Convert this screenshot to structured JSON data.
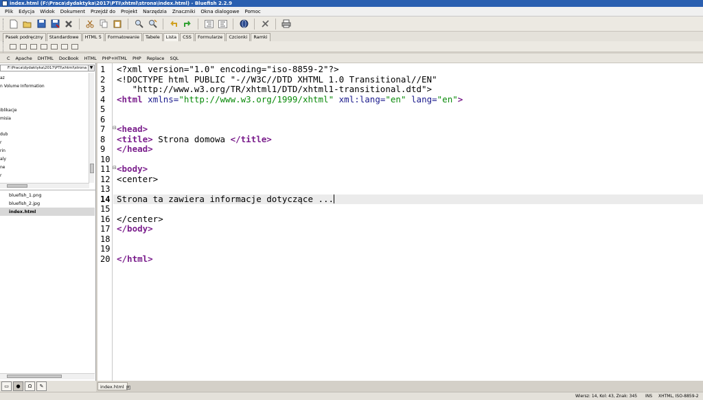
{
  "window": {
    "title": "index.html (F:\\Praca\\dydaktyka\\2017\\PTI\\xhtml\\strona\\index.html) - Bluefish 2.2.9"
  },
  "menu": [
    "Plik",
    "Edycja",
    "Widok",
    "Dokument",
    "Przejdź do",
    "Projekt",
    "Narzędzia",
    "Znaczniki",
    "Okna dialogowe",
    "Pomoc"
  ],
  "toolbar_icons": [
    "new-file-icon",
    "open-folder-icon",
    "save-icon",
    "save-as-icon",
    "close-icon",
    "cut-icon",
    "copy-icon",
    "paste-icon",
    "find-icon",
    "replace-icon",
    "undo-icon",
    "redo-icon",
    "indent-icon",
    "unindent-icon",
    "globe-icon",
    "tools-icon",
    "print-icon"
  ],
  "tabs": [
    "Pasek podręczny",
    "Standardowe",
    "HTML 5",
    "Formatowanie",
    "Tabele",
    "Lista",
    "CSS",
    "Formularze",
    "Czcionki",
    "Ramki"
  ],
  "active_tab": "Lista",
  "filebar": [
    "C",
    "Apache",
    "DHTML",
    "DocBook",
    "HTML",
    "PHP+HTML",
    "PHP",
    "Replace",
    "SQL"
  ],
  "left_panel": {
    "path": "F:\\Praca\\dydaktyka\\2017\\PTI\\xhtml\\strona",
    "tree": [
      "az",
      "n Volume Information",
      "iblikacje",
      "misia",
      "dub",
      "r",
      "rin",
      "aly",
      "ne",
      "r"
    ],
    "files": [
      "bluefish_1.png",
      "bluefish_2.jpg",
      "index.html"
    ],
    "active_file": "index.html"
  },
  "editor": {
    "lines": [
      "<?xml version=\"1.0\" encoding=\"iso-8859-2\"?>",
      "<!DOCTYPE html PUBLIC \"-//W3C//DTD XHTML 1.0 Transitional//EN\"",
      "   \"http://www.w3.org/TR/xhtml1/DTD/xhtml1-transitional.dtd\">",
      "<html xmlns=\"http://www.w3.org/1999/xhtml\" xml:lang=\"en\" lang=\"en\">",
      "",
      "",
      "<head>",
      "<title> Strona domowa </title>",
      "</head>",
      "",
      "<body>",
      "<center>",
      "",
      "Strona ta zawiera informacje dotyczące ...",
      "",
      "</center>",
      "</body>",
      "",
      "",
      "</html>"
    ],
    "current_line": 14,
    "tab_label": "index.html"
  },
  "status": {
    "position": "Wiersz: 14, Kol: 43, Znak: 345",
    "mode": "INS",
    "encoding": "XHTML, ISO-8859-2"
  },
  "colors": {
    "tag": "#7a1e8c",
    "attribute": "#1a1a8c",
    "string": "#0a8a0a",
    "titlebar": "#2a5fb0"
  }
}
